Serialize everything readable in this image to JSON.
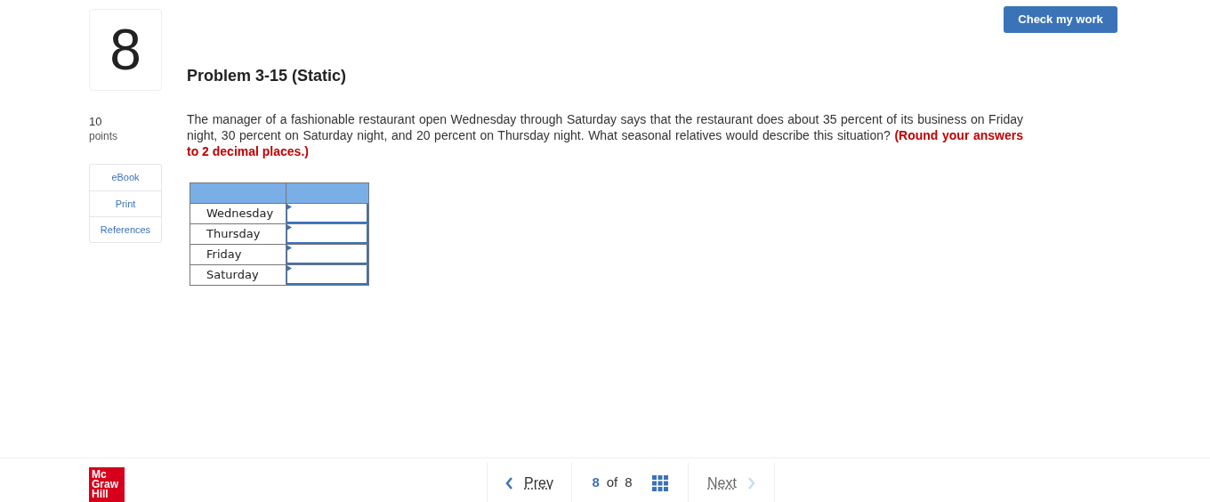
{
  "question_number": "8",
  "check_button": "Check my work",
  "title": "Problem 3-15 (Static)",
  "points": {
    "value": "10",
    "label": "points"
  },
  "resources": [
    "eBook",
    "Print",
    "References"
  ],
  "prompt": "The manager of a fashionable restaurant open Wednesday through Saturday says that the restaurant does about 35 percent of its business on Friday night, 30 percent on Saturday night, and 20 percent on Thursday night. What seasonal relatives would describe this situation? **(Round your answers to 2 decimal places.)**",
  "table": {
    "rows": [
      {
        "label": "Wednesday"
      },
      {
        "label": "Thursday"
      },
      {
        "label": "Friday"
      },
      {
        "label": "Saturday"
      }
    ]
  },
  "logo": [
    "Mc",
    "Graw",
    "Hill"
  ],
  "nav": {
    "prev": {
      "label": "Prev",
      "disabled": false
    },
    "current": "8",
    "of": "of",
    "total": "8",
    "next": {
      "label": "Next",
      "disabled": true
    }
  }
}
